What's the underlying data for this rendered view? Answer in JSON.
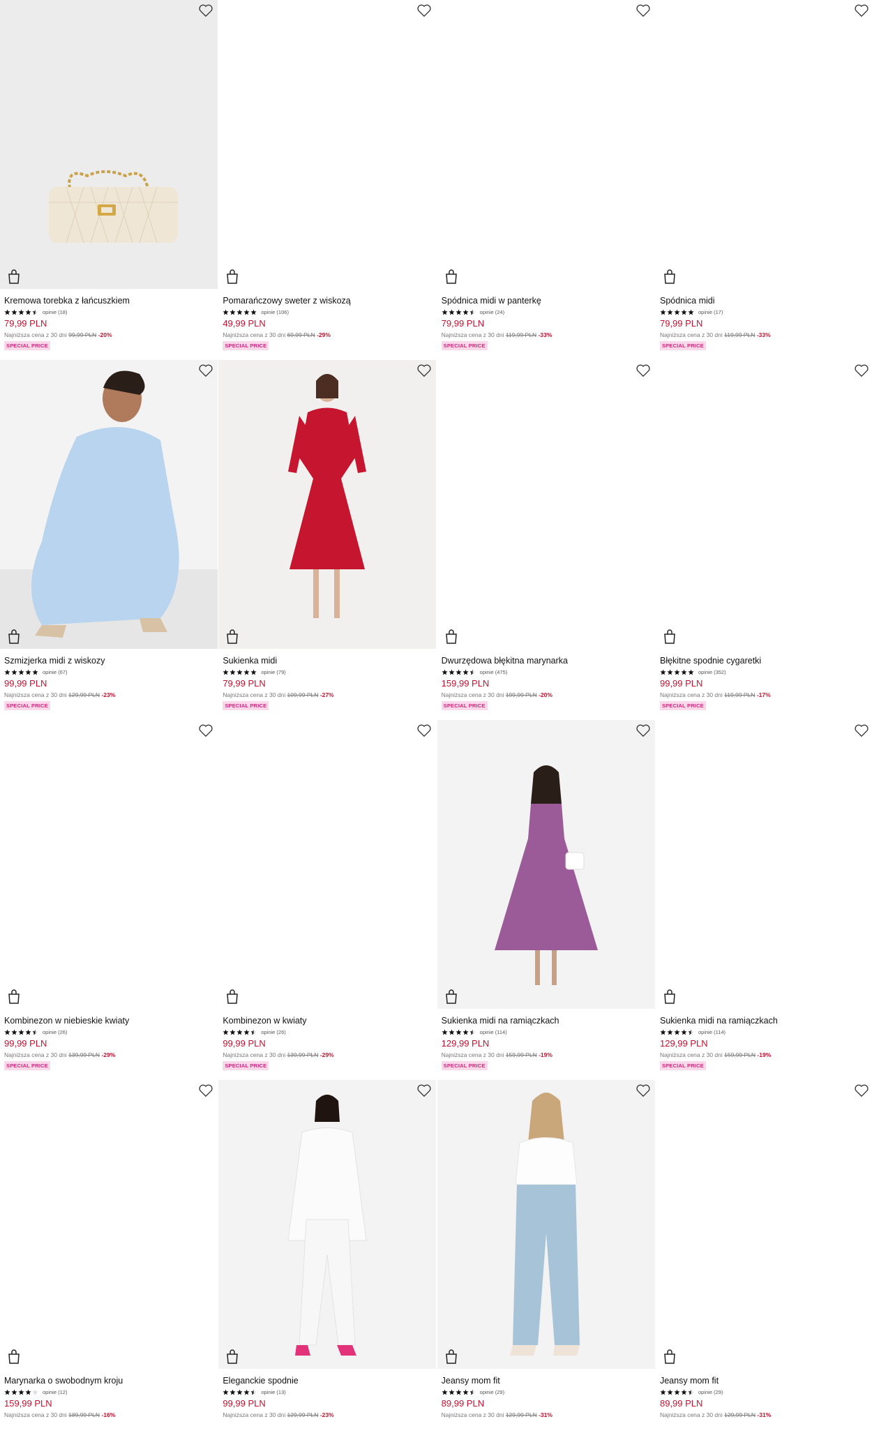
{
  "lowest_prefix": "Najniższa cena z 30 dni",
  "products": [
    {
      "name": "Kremowa torebka z łańcuszkiem",
      "stars": 4.5,
      "reviews": "opinie (18)",
      "price": "79,99 PLN",
      "old_price": "99,99 PLN",
      "discount": "-20%",
      "badge": "SPECIAL PRICE"
    },
    {
      "name": "Pomarańczowy sweter z wiskozą",
      "stars": 5,
      "reviews": "opinie (106)",
      "price": "49,99 PLN",
      "old_price": "69,99 PLN",
      "discount": "-29%",
      "badge": "SPECIAL PRICE"
    },
    {
      "name": "Spódnica midi w panterkę",
      "stars": 4.5,
      "reviews": "opinie (24)",
      "price": "79,99 PLN",
      "old_price": "119,99 PLN",
      "discount": "-33%",
      "badge": "SPECIAL PRICE"
    },
    {
      "name": "Spódnica midi",
      "stars": 5,
      "reviews": "opinie (17)",
      "price": "79,99 PLN",
      "old_price": "119,99 PLN",
      "discount": "-33%",
      "badge": "SPECIAL PRICE"
    },
    {
      "name": "Szmizjerka midi z wiskozy",
      "stars": 5,
      "reviews": "opinie (67)",
      "price": "99,99 PLN",
      "old_price": "129,99 PLN",
      "discount": "-23%",
      "badge": "SPECIAL PRICE"
    },
    {
      "name": "Sukienka midi",
      "stars": 5,
      "reviews": "opinie (79)",
      "price": "79,99 PLN",
      "old_price": "109,99 PLN",
      "discount": "-27%",
      "badge": "SPECIAL PRICE"
    },
    {
      "name": "Dwurzędowa błękitna marynarka",
      "stars": 4.5,
      "reviews": "opinie (475)",
      "price": "159,99 PLN",
      "old_price": "199,99 PLN",
      "discount": "-20%",
      "badge": "SPECIAL PRICE"
    },
    {
      "name": "Błękitne spodnie cygaretki",
      "stars": 5,
      "reviews": "opinie (352)",
      "price": "99,99 PLN",
      "old_price": "119,99 PLN",
      "discount": "-17%",
      "badge": "SPECIAL PRICE"
    },
    {
      "name": "Kombinezon w niebieskie kwiaty",
      "stars": 4.5,
      "reviews": "opinie (26)",
      "price": "99,99 PLN",
      "old_price": "139,99 PLN",
      "discount": "-29%",
      "badge": "SPECIAL PRICE"
    },
    {
      "name": "Kombinezon w kwiaty",
      "stars": 4.5,
      "reviews": "opinie (26)",
      "price": "99,99 PLN",
      "old_price": "139,99 PLN",
      "discount": "-29%",
      "badge": "SPECIAL PRICE"
    },
    {
      "name": "Sukienka midi na ramiączkach",
      "stars": 4.5,
      "reviews": "opinie (114)",
      "price": "129,99 PLN",
      "old_price": "159,99 PLN",
      "discount": "-19%",
      "badge": "SPECIAL PRICE"
    },
    {
      "name": "Sukienka midi na ramiączkach",
      "stars": 4.5,
      "reviews": "opinie (114)",
      "price": "129,99 PLN",
      "old_price": "159,99 PLN",
      "discount": "-19%",
      "badge": "SPECIAL PRICE"
    },
    {
      "name": "Marynarka o swobodnym kroju",
      "stars": 4,
      "reviews": "opinie (12)",
      "price": "159,99 PLN",
      "old_price": "189,99 PLN",
      "discount": "-16%",
      "badge": ""
    },
    {
      "name": "Eleganckie spodnie",
      "stars": 4.5,
      "reviews": "opinie (13)",
      "price": "99,99 PLN",
      "old_price": "129,99 PLN",
      "discount": "-23%",
      "badge": ""
    },
    {
      "name": "Jeansy mom fit",
      "stars": 4.5,
      "reviews": "opinie (29)",
      "price": "89,99 PLN",
      "old_price": "129,99 PLN",
      "discount": "-31%",
      "badge": ""
    },
    {
      "name": "Jeansy mom fit",
      "stars": 4.5,
      "reviews": "opinie (29)",
      "price": "89,99 PLN",
      "old_price": "129,99 PLN",
      "discount": "-31%",
      "badge": ""
    }
  ],
  "colors": {
    "price": "#c5112f",
    "badge_bg": "#fbd7ea",
    "badge_text": "#d7227c"
  },
  "icons": {
    "favorite": "heart-icon",
    "cart": "shopping-bag-icon",
    "rating": "star-icon"
  }
}
